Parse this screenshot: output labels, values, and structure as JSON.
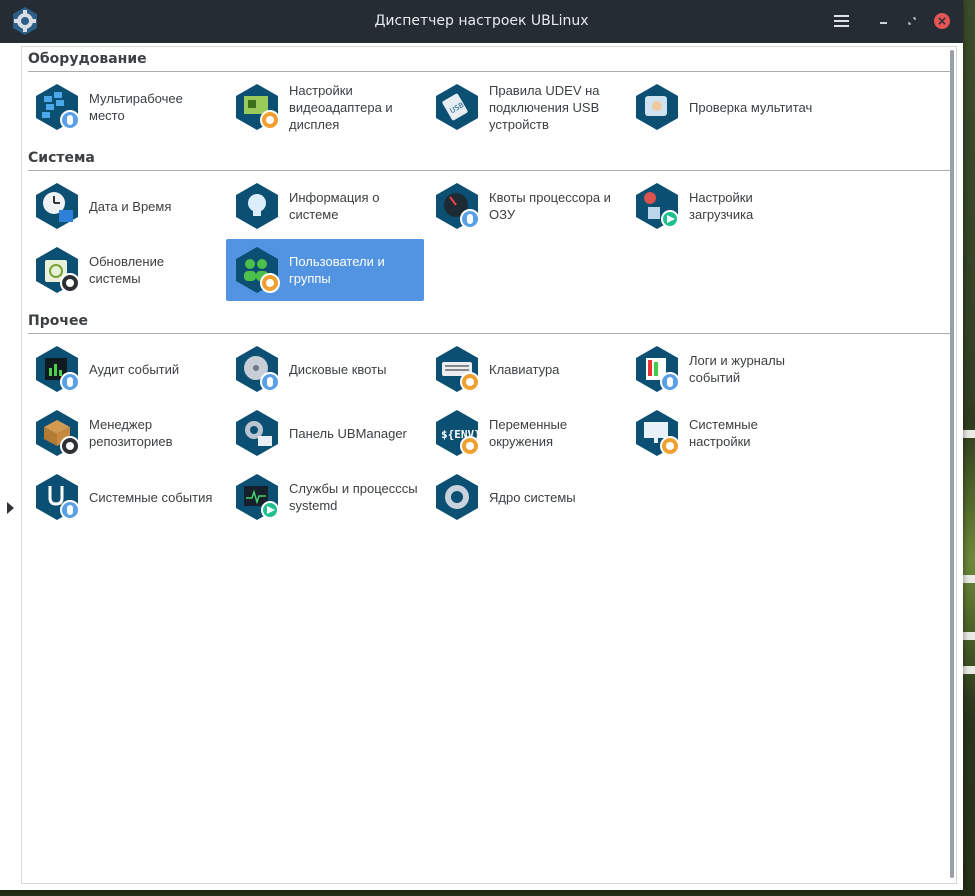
{
  "window": {
    "title": "Диспетчер настроек UBLinux"
  },
  "titlebar": {
    "menu_icon": "hamburger-icon",
    "minimize_icon": "minimize-icon",
    "maximize_icon": "maximize-icon",
    "close_icon": "close-icon",
    "close_color": "#e25555"
  },
  "colors": {
    "selection": "#5294e2",
    "icon_hex": "#0b4f73",
    "badge_blue": "#5aa0e6",
    "badge_orange": "#f0a030"
  },
  "sections": [
    {
      "title": "Оборудование",
      "items": [
        {
          "label": "Мультирабочее\nместо",
          "icon": "multiseat-icon"
        },
        {
          "label": "Настройки\nвидеоадаптера и\nдисплея",
          "icon": "video-adapter-icon"
        },
        {
          "label": "Правила UDEV на\nподключения USB\nустройств",
          "icon": "usb-icon"
        },
        {
          "label": "Проверка мультитач",
          "icon": "multitouch-icon"
        }
      ]
    },
    {
      "title": "Система",
      "items": [
        {
          "label": "Дата и Время",
          "icon": "clock-calendar-icon"
        },
        {
          "label": "Информация о\nсистеме",
          "icon": "lightbulb-icon"
        },
        {
          "label": "Квоты процессора и\nОЗУ",
          "icon": "gauge-icon"
        },
        {
          "label": "Настройки\nзагрузчика",
          "icon": "bootloader-icon"
        },
        {
          "label": "Обновление\nсистемы",
          "icon": "update-icon"
        },
        {
          "label": "Пользователи и\nгруппы",
          "icon": "users-icon",
          "selected": true
        }
      ]
    },
    {
      "title": "Прочее",
      "items": [
        {
          "label": "Аудит событий",
          "icon": "audit-icon"
        },
        {
          "label": "Дисковые квоты",
          "icon": "disk-icon"
        },
        {
          "label": "Клавиатура",
          "icon": "keyboard-icon"
        },
        {
          "label": "Логи и журналы\nсобытий",
          "icon": "logs-icon"
        },
        {
          "label": "Менеджер\nрепозиториев",
          "icon": "package-icon"
        },
        {
          "label": "Панель UBManager",
          "icon": "ubmanager-icon"
        },
        {
          "label": "Переменные\nокружения",
          "icon": "env-icon"
        },
        {
          "label": "Системные\nнастройки",
          "icon": "monitor-settings-icon"
        },
        {
          "label": "Системные события",
          "icon": "system-events-icon"
        },
        {
          "label": "Службы и процесссы\nsystemd",
          "icon": "systemd-icon"
        },
        {
          "label": "Ядро системы",
          "icon": "kernel-gear-icon"
        }
      ]
    }
  ]
}
